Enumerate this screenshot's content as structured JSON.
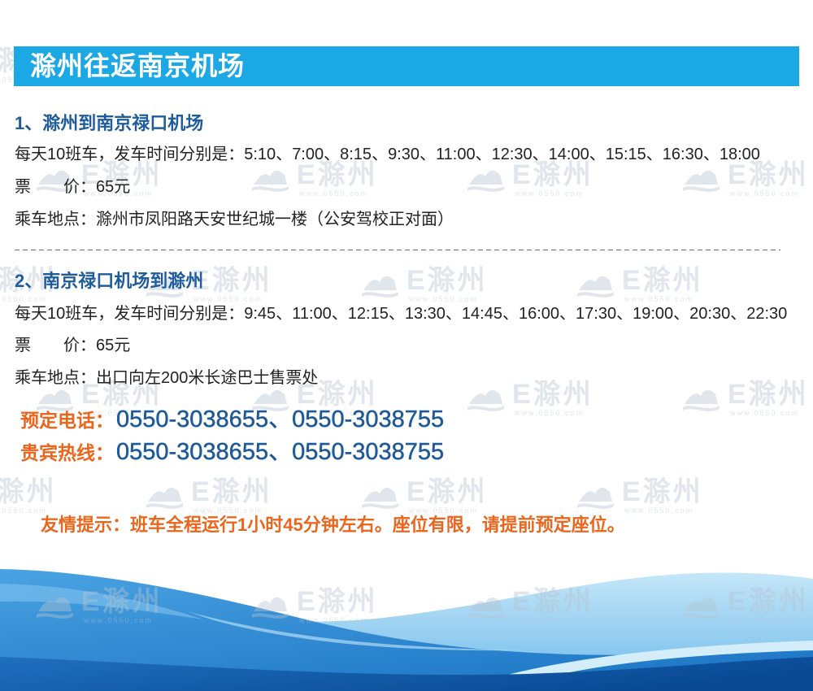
{
  "banner": {
    "title": "滁州往返南京机场"
  },
  "routes": [
    {
      "heading": "1、滁州到南京禄口机场",
      "schedule_label": "每天10班车，发车时间分别是：",
      "departures": [
        "5:10",
        "7:00",
        "8:15",
        "9:30",
        "11:00",
        "12:30",
        "14:00",
        "15:15",
        "16:30",
        "18:00"
      ],
      "price_label": "票　　价：",
      "price": "65元",
      "pickup_label": "乘车地点：",
      "pickup": "滁州市凤阳路天安世纪城一楼（公安驾校正对面）"
    },
    {
      "heading": "2、南京禄口机场到滁州",
      "schedule_label": "每天10班车，发车时间分别是：",
      "departures": [
        "9:45",
        "11:00",
        "12:15",
        "13:30",
        "14:45",
        "16:00",
        "17:30",
        "19:00",
        "20:30",
        "22:30"
      ],
      "price_label": "票　　价：",
      "price": "65元",
      "pickup_label": "乘车地点：",
      "pickup": "出口向左200米长途巴士售票处"
    }
  ],
  "list_separator": "、",
  "contacts": [
    {
      "label": "预定电话：",
      "numbers": [
        "0550-3038655",
        "0550-3038755"
      ]
    },
    {
      "label": "贵宾热线：",
      "numbers": [
        "0550-3038655",
        "0550-3038755"
      ]
    }
  ],
  "tip": {
    "label": "友情提示：",
    "text": "班车全程运行1小时45分钟左右。座位有限，请提前预定座位。"
  },
  "watermark": {
    "brand": "E滁州",
    "url": "www.0550.com",
    "icon": "mountain-wave-logo-icon"
  },
  "colors": {
    "banner": "#1ca8e4",
    "heading": "#1f5c9c",
    "body_text": "#222222",
    "accent_orange": "#e9661c",
    "phone_blue": "#1f5a99"
  }
}
